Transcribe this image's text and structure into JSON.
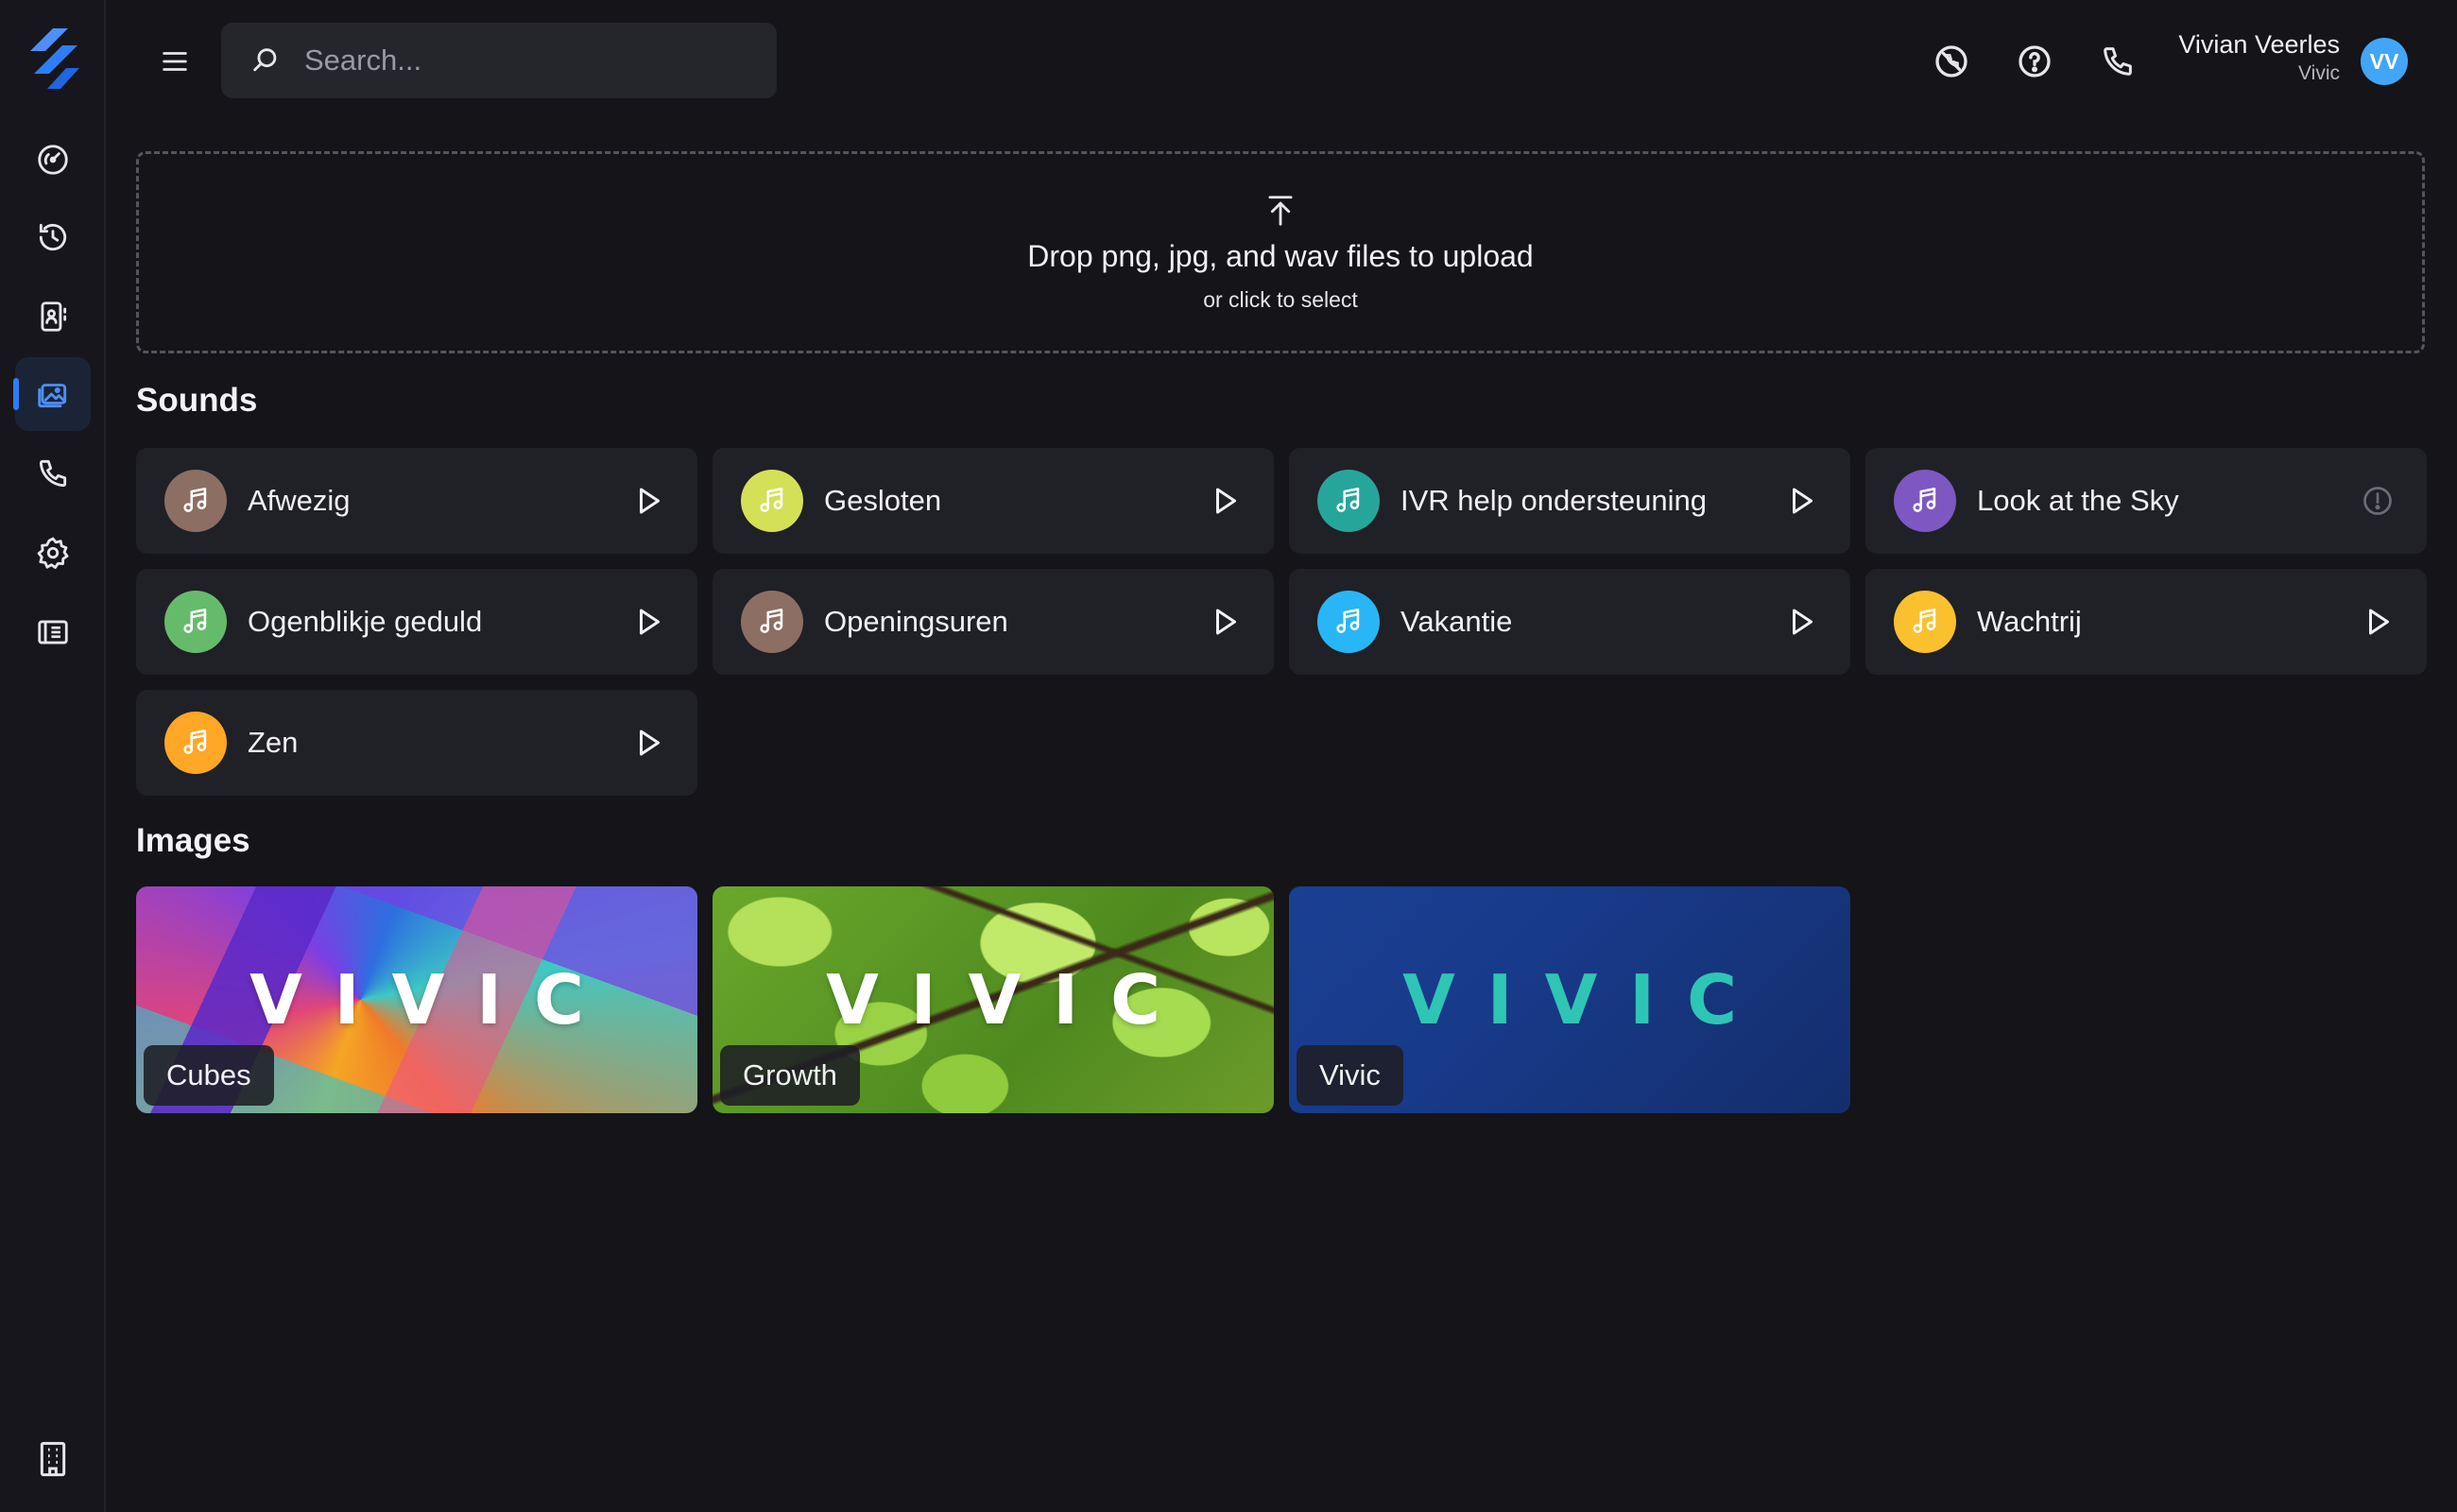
{
  "search": {
    "placeholder": "Search..."
  },
  "user": {
    "name": "Vivian Veerles",
    "company": "Vivic",
    "initials": "VV"
  },
  "dropzone": {
    "title": "Drop png, jpg, and wav files to upload",
    "subtitle": "or click to select"
  },
  "sounds": {
    "title": "Sounds",
    "items": [
      {
        "name": "Afwezig",
        "icon_color": "#8d6e63",
        "action": "play"
      },
      {
        "name": "Gesloten",
        "icon_color": "#d4e157",
        "action": "play"
      },
      {
        "name": "IVR help ondersteuning",
        "icon_color": "#26a69a",
        "action": "play"
      },
      {
        "name": "Look at the Sky",
        "icon_color": "#7e57c2",
        "action": "warning"
      },
      {
        "name": "Ogenblikje geduld",
        "icon_color": "#66bb6a",
        "action": "play"
      },
      {
        "name": "Openingsuren",
        "icon_color": "#8d6e63",
        "action": "play"
      },
      {
        "name": "Vakantie",
        "icon_color": "#29b6f6",
        "action": "play"
      },
      {
        "name": "Wachtrij",
        "icon_color": "#fbc02d",
        "action": "play"
      },
      {
        "name": "Zen",
        "icon_color": "#ffa726",
        "action": "play"
      }
    ]
  },
  "images": {
    "title": "Images",
    "items": [
      {
        "name": "Cubes",
        "wordmark": "VIVIC"
      },
      {
        "name": "Growth",
        "wordmark": "VIVIC"
      },
      {
        "name": "Vivic",
        "wordmark": "VIVIC"
      }
    ]
  },
  "theme": {
    "accent": "#2f7df6",
    "background": "#141419",
    "card": "#202027",
    "wordmark_teal": "#2fc5b4"
  },
  "icons": {
    "sidebar": [
      "dashboard-icon",
      "history-icon",
      "contacts-icon",
      "media-icon",
      "phone-icon",
      "settings-icon",
      "reports-icon"
    ],
    "topbar": [
      "no-disturb-icon",
      "help-icon",
      "phone-icon"
    ],
    "bottom": "building-icon"
  }
}
